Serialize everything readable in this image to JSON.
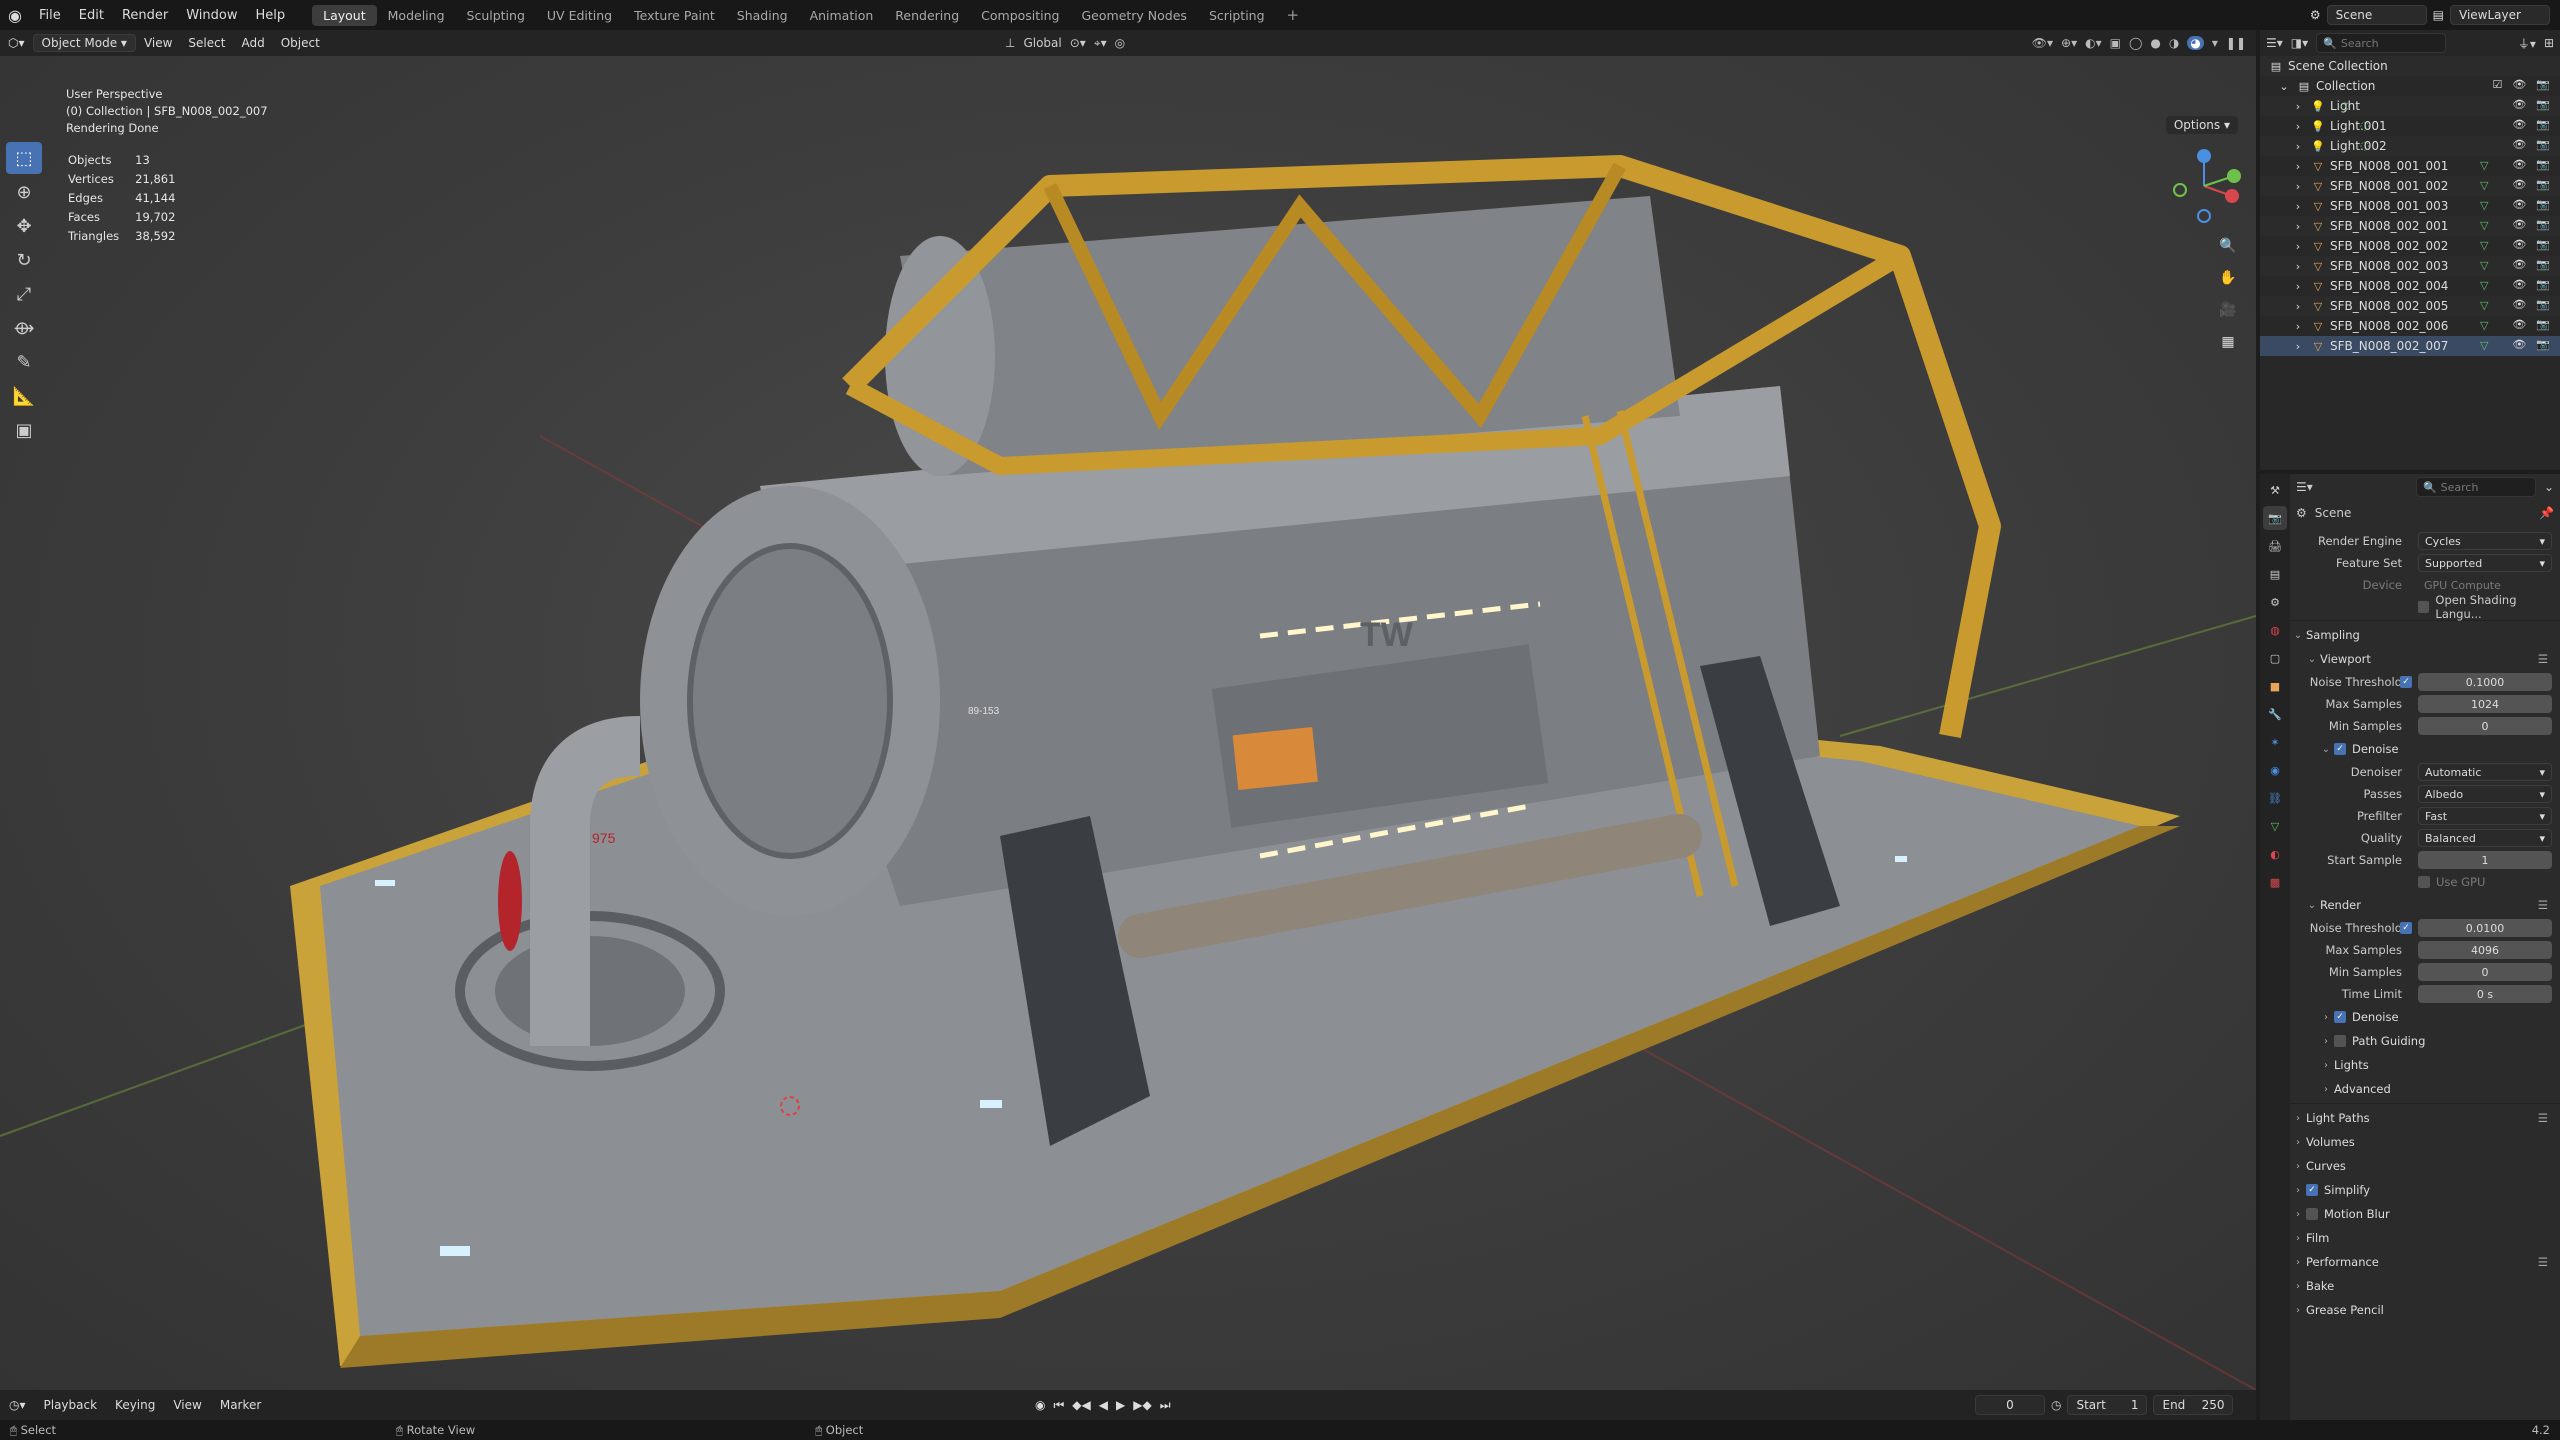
{
  "topbar": {
    "menu": [
      "File",
      "Edit",
      "Render",
      "Window",
      "Help"
    ],
    "workspaces": [
      "Layout",
      "Modeling",
      "Sculpting",
      "UV Editing",
      "Texture Paint",
      "Shading",
      "Animation",
      "Rendering",
      "Compositing",
      "Geometry Nodes",
      "Scripting"
    ],
    "active_workspace": "Layout",
    "scene": "Scene",
    "view_layer": "ViewLayer"
  },
  "viewport_header": {
    "mode": "Object Mode",
    "menus": [
      "View",
      "Select",
      "Add",
      "Object"
    ],
    "orientation": "Global",
    "options": "Options"
  },
  "viewport": {
    "perspective": "User Perspective",
    "collection_line": "(0) Collection | SFB_N008_002_007",
    "status": "Rendering Done",
    "stats": [
      {
        "label": "Objects",
        "value": "13"
      },
      {
        "label": "Vertices",
        "value": "21,861"
      },
      {
        "label": "Edges",
        "value": "41,144"
      },
      {
        "label": "Faces",
        "value": "19,702"
      },
      {
        "label": "Triangles",
        "value": "38,592"
      }
    ],
    "model_labels": {
      "brand": "TW",
      "valve_tag": "975",
      "panel_id": "89-153"
    }
  },
  "timeline": {
    "menus": [
      "Playback",
      "Keying",
      "View",
      "Marker"
    ],
    "current_frame": "0",
    "start_label": "Start",
    "start": "1",
    "end_label": "End",
    "end": "250"
  },
  "statusbar": {
    "items": [
      "Select",
      "Rotate View",
      "Object"
    ],
    "version": "4.2"
  },
  "outliner": {
    "search_placeholder": "Search",
    "root": "Scene Collection",
    "collection": "Collection",
    "items": [
      {
        "name": "Light",
        "type": "light"
      },
      {
        "name": "Light.001",
        "type": "light"
      },
      {
        "name": "Light.002",
        "type": "light"
      },
      {
        "name": "SFB_N008_001_001",
        "type": "mesh"
      },
      {
        "name": "SFB_N008_001_002",
        "type": "mesh"
      },
      {
        "name": "SFB_N008_001_003",
        "type": "mesh"
      },
      {
        "name": "SFB_N008_002_001",
        "type": "mesh"
      },
      {
        "name": "SFB_N008_002_002",
        "type": "mesh"
      },
      {
        "name": "SFB_N008_002_003",
        "type": "mesh"
      },
      {
        "name": "SFB_N008_002_004",
        "type": "mesh"
      },
      {
        "name": "SFB_N008_002_005",
        "type": "mesh"
      },
      {
        "name": "SFB_N008_002_006",
        "type": "mesh"
      },
      {
        "name": "SFB_N008_002_007",
        "type": "mesh"
      }
    ]
  },
  "properties": {
    "search_placeholder": "Search",
    "context": "Scene",
    "render_engine": {
      "label": "Render Engine",
      "value": "Cycles"
    },
    "feature_set": {
      "label": "Feature Set",
      "value": "Supported"
    },
    "device": {
      "label": "Device",
      "value": "GPU Compute"
    },
    "osl": "Open Shading Langu...",
    "sampling": "Sampling",
    "viewport": {
      "title": "Viewport",
      "noise_threshold": {
        "label": "Noise Threshold",
        "value": "0.1000"
      },
      "max_samples": {
        "label": "Max Samples",
        "value": "1024"
      },
      "min_samples": {
        "label": "Min Samples",
        "value": "0"
      },
      "denoise": "Denoise",
      "denoiser": {
        "label": "Denoiser",
        "value": "Automatic"
      },
      "passes": {
        "label": "Passes",
        "value": "Albedo"
      },
      "prefilter": {
        "label": "Prefilter",
        "value": "Fast"
      },
      "quality": {
        "label": "Quality",
        "value": "Balanced"
      },
      "start_sample": {
        "label": "Start Sample",
        "value": "1"
      },
      "use_gpu": "Use GPU"
    },
    "render": {
      "title": "Render",
      "noise_threshold": {
        "label": "Noise Threshold",
        "value": "0.0100"
      },
      "max_samples": {
        "label": "Max Samples",
        "value": "4096"
      },
      "min_samples": {
        "label": "Min Samples",
        "value": "0"
      },
      "time_limit": {
        "label": "Time Limit",
        "value": "0 s"
      },
      "subpanels": [
        "Denoise",
        "Path Guiding",
        "Lights",
        "Advanced"
      ]
    },
    "panels": [
      "Light Paths",
      "Volumes",
      "Curves",
      "Simplify",
      "Motion Blur",
      "Film",
      "Performance",
      "Bake",
      "Grease Pencil"
    ]
  },
  "colors": {
    "accent": "#4772b3",
    "mesh_icon": "#e8a55a",
    "light_icon": "#f0c060",
    "gizmo_x": "#d9474e",
    "gizmo_y": "#6ec24b",
    "gizmo_z": "#4a8fe0"
  }
}
